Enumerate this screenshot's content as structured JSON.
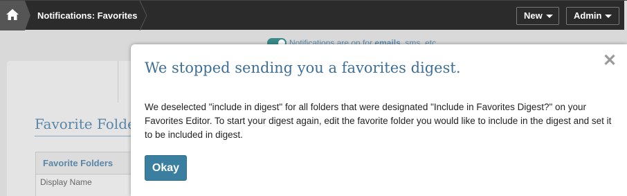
{
  "topbar": {
    "home_icon": "home-icon",
    "breadcrumb": "Notifications: Favorites",
    "new_button": "New",
    "admin_button": "Admin"
  },
  "background": {
    "notification_prefix": "Notifications are on for ",
    "notification_bold": "emails",
    "notification_suffix": ", sms, etc",
    "section_heading": "Favorite Folders",
    "table_header": "Favorite Folders",
    "column_display_name": "Display Name"
  },
  "modal": {
    "title": "We stopped sending you a favorites digest.",
    "close_icon": "close-icon",
    "body": "We deselected \"include in digest\" for all folders that were designated \"Include in Favorites Digest?\" on your Favorites Editor. To start your digest again, edit the favorite folder you would like to include in the digest and set it to be included in digest.",
    "okay_button": "Okay"
  },
  "colors": {
    "topbar": "#2b2b2b",
    "accent": "#3a7ea0",
    "title_blue": "#3f6f96"
  }
}
